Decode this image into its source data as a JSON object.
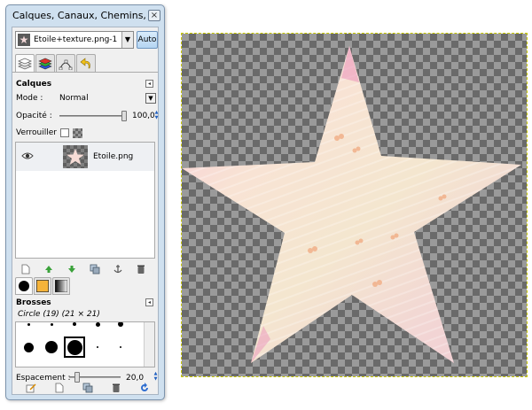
{
  "window": {
    "title": "Calques, Canaux, Chemins, ..."
  },
  "image_selector": {
    "value": "Etoile+texture.png-1",
    "auto_label": "Auto"
  },
  "layers_panel": {
    "title": "Calques",
    "mode_label": "Mode :",
    "mode_value": "Normal",
    "opacity_label": "Opacité :",
    "opacity_value": "100,0",
    "lock_label": "Verrouiller :",
    "layers": [
      {
        "name": "Etoile.png",
        "visible": true
      }
    ]
  },
  "brushes_panel": {
    "title": "Brosses",
    "selected_brush": "Circle (19) (21 × 21)",
    "spacing_label": "Espacement :",
    "spacing_value": "20,0"
  },
  "colors": {
    "canvas_checker_dark": "#6a6a6a",
    "canvas_checker_light": "#9a9a9a",
    "star_fill": "#f3d3cf"
  }
}
